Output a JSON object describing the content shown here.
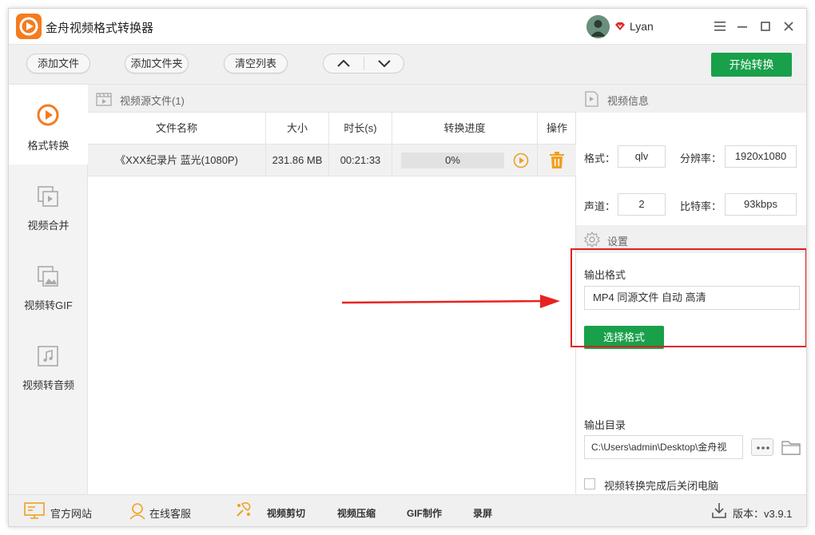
{
  "app": {
    "title": "金舟视频格式转换器",
    "accent": "#19a04a",
    "logo_color": "#f47b20"
  },
  "user": {
    "name": "Lyan"
  },
  "window_controls": {
    "menu": "☰",
    "minimize": "—",
    "maximize": "☐",
    "close": "✕"
  },
  "toolbar": {
    "add_file": "添加文件",
    "add_folder": "添加文件夹",
    "clear_list": "清空列表",
    "start_convert": "开始转换"
  },
  "sidebar": {
    "items": [
      {
        "label": "格式转换",
        "icon": "convert-icon",
        "active": true
      },
      {
        "label": "视频合并",
        "icon": "merge-icon",
        "active": false
      },
      {
        "label": "视频转GIF",
        "icon": "gif-icon",
        "active": false
      },
      {
        "label": "视频转音频",
        "icon": "audio-icon",
        "active": false
      }
    ]
  },
  "file_panel": {
    "header": "视频源文件(1)",
    "columns": [
      "文件名称",
      "大小",
      "时长(s)",
      "转换进度",
      "操作"
    ],
    "rows": [
      {
        "name": "《XXX纪录片 蓝光(1080P)",
        "size": "231.86 MB",
        "duration": "00:21:33",
        "progress": "0%"
      }
    ]
  },
  "video_info": {
    "header": "视频信息",
    "format_label": "格式：",
    "format_value": "qlv",
    "resolution_label": "分辨率：",
    "resolution_value": "1920x1080",
    "channels_label": "声道：",
    "channels_value": "2",
    "bitrate_label": "比特率：",
    "bitrate_value": "93kbps"
  },
  "settings": {
    "header": "设置",
    "output_format_label": "输出格式",
    "output_format_value": "MP4 同源文件 自动 高清",
    "select_format": "选择格式",
    "output_dir_label": "输出目录",
    "output_dir_value": "C:\\Users\\admin\\Desktop\\金舟视",
    "shutdown_label": "视频转换完成后关闭电脑"
  },
  "bottom_bar": {
    "website": "官方网站",
    "support": "在线客服",
    "video_edit": "视频剪切",
    "video_compress": "视频压缩",
    "gif_make": "GIF制作",
    "record": "录屏",
    "version": "版本：v3.9.1"
  }
}
